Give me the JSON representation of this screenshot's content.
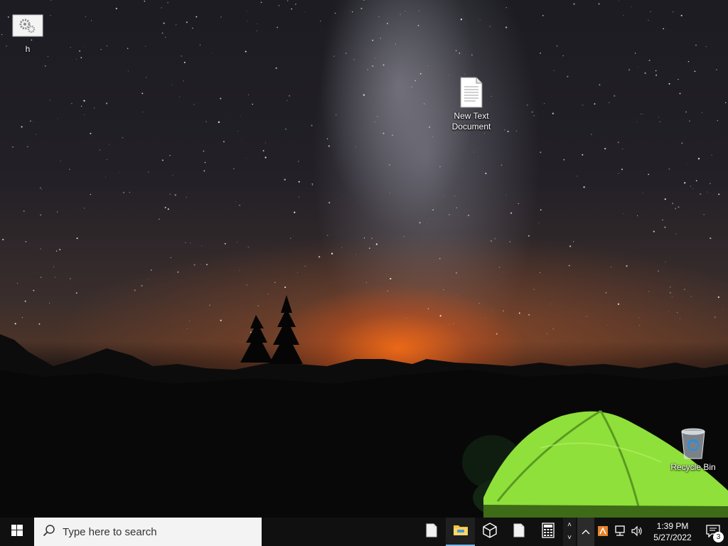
{
  "desktop": {
    "icons": [
      {
        "id": "h",
        "label": "h",
        "icon": "settings-gears-icon"
      },
      {
        "id": "new-text-document",
        "label": "New Text\nDocument",
        "icon": "text-document-icon"
      },
      {
        "id": "recycle-bin",
        "label": "Recycle Bin",
        "icon": "recycle-bin-icon"
      }
    ]
  },
  "taskbar": {
    "start_icon": "windows-logo-icon",
    "search": {
      "placeholder": "Type here to search",
      "icon": "search-icon"
    },
    "pinned": [
      {
        "name": "document-app",
        "icon": "blank-document-icon",
        "active": false
      },
      {
        "name": "file-explorer",
        "icon": "folder-icon",
        "active": true
      },
      {
        "name": "3d-viewer",
        "icon": "cube-icon",
        "active": false
      },
      {
        "name": "notepad-window",
        "icon": "blank-document-icon",
        "active": false
      },
      {
        "name": "calculator",
        "icon": "calculator-icon",
        "active": false
      }
    ],
    "tray": {
      "overflow_icon": "chevron-up-icon",
      "icons": [
        "app-tray-icon",
        "network-icon",
        "volume-icon"
      ],
      "time": "1:39 PM",
      "date": "5/27/2022",
      "notification_count": "3"
    }
  },
  "colors": {
    "taskbar_bg": "#101010",
    "search_bg": "#f3f3f3",
    "active_indicator": "#76b9ed",
    "tent_green": "#8fe03a",
    "sunset_orange": "#ff6a14"
  }
}
